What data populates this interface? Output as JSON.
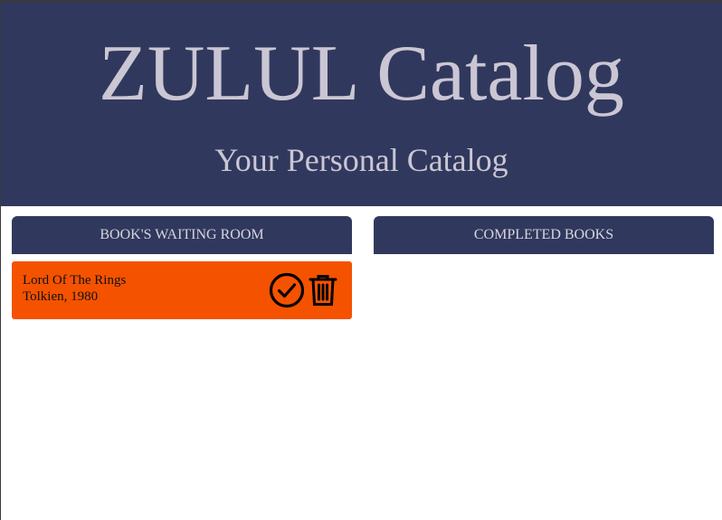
{
  "header": {
    "title": "ZULUL Catalog",
    "subtitle": "Your Personal Catalog"
  },
  "columns": {
    "waiting": {
      "label": "BOOK'S WAITING ROOM"
    },
    "completed": {
      "label": "COMPLETED BOOKS"
    }
  },
  "waiting_books": [
    {
      "title": "Lord Of The Rings",
      "meta": "Tolkien, 1980",
      "actions": {
        "complete_icon": "check-circle-icon",
        "delete_icon": "trash-icon"
      }
    }
  ],
  "colors": {
    "header_bg": "#30395d",
    "title_text": "#cbc6d4",
    "card_bg": "#f55200",
    "card_text": "#111111"
  }
}
